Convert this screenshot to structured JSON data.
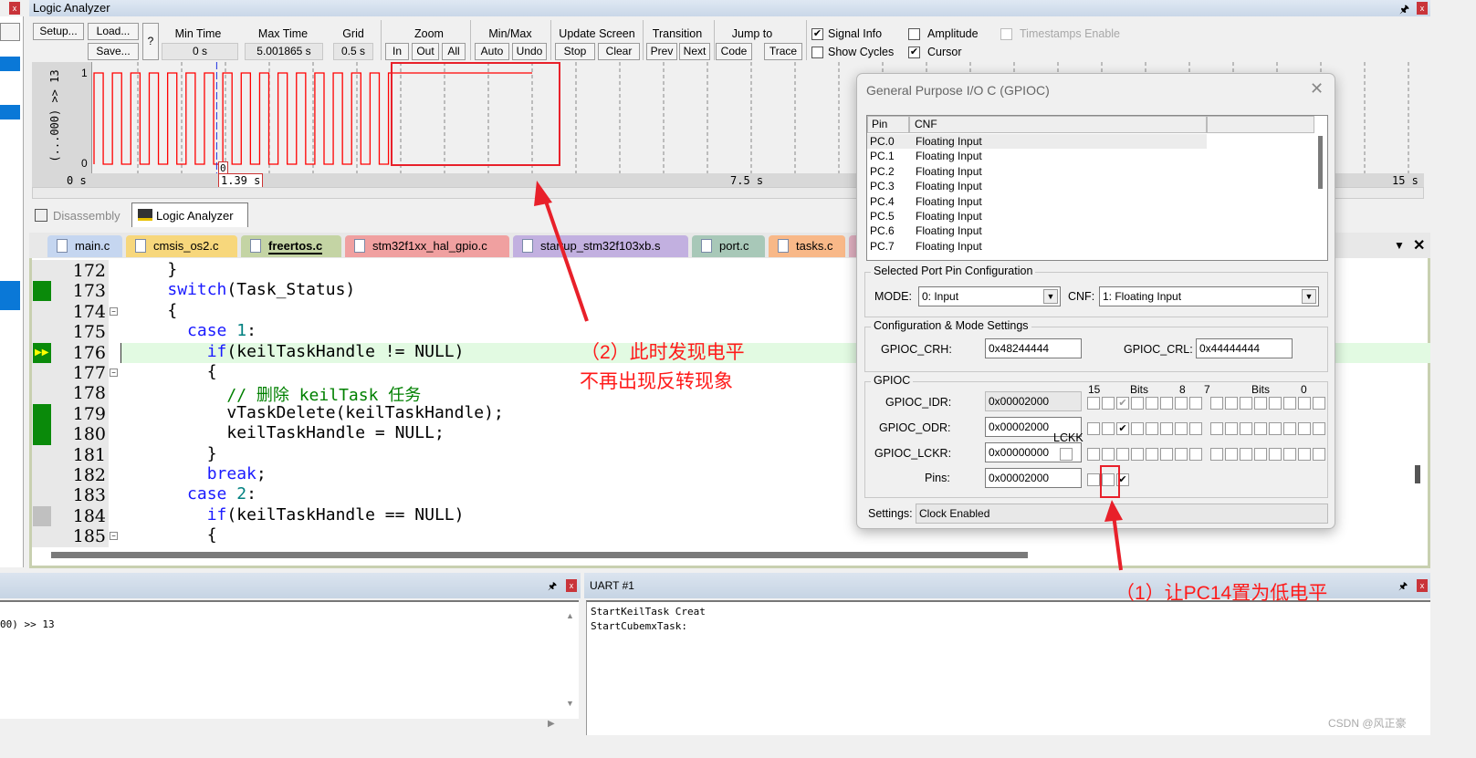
{
  "logic_analyzer": {
    "title": "Logic Analyzer",
    "buttons": {
      "setup": "Setup...",
      "load": "Load...",
      "save": "Save...",
      "help": "?"
    },
    "min_time": {
      "label": "Min Time",
      "value": "0 s"
    },
    "max_time": {
      "label": "Max Time",
      "value": "5.001865 s"
    },
    "grid": {
      "label": "Grid",
      "value": "0.5 s"
    },
    "zoom": {
      "label": "Zoom",
      "in": "In",
      "out": "Out",
      "all": "All"
    },
    "minmax": {
      "label": "Min/Max",
      "auto": "Auto",
      "undo": "Undo"
    },
    "update": {
      "label": "Update Screen",
      "stop": "Stop",
      "clear": "Clear"
    },
    "transition": {
      "label": "Transition",
      "prev": "Prev",
      "next": "Next"
    },
    "jump": {
      "label": "Jump to",
      "code": "Code",
      "trace": "Trace"
    },
    "options": [
      {
        "label": "Signal Info",
        "checked": true,
        "enabled": true
      },
      {
        "label": "Amplitude",
        "checked": false,
        "enabled": true
      },
      {
        "label": "Timestamps Enable",
        "checked": false,
        "enabled": false
      },
      {
        "label": "Show Cycles",
        "checked": false,
        "enabled": true
      },
      {
        "label": "Cursor",
        "checked": true,
        "enabled": true
      }
    ],
    "signal_name": "(...000) >> 13",
    "level_high": "1",
    "level_low": "0",
    "cursor_value": "0",
    "cursor_time": "1.39 s",
    "axis": {
      "start": "0 s",
      "mid": "7.5 s",
      "end": "15 s"
    },
    "waveform": {
      "period_s": 0.21,
      "toggle_until_s": 3.45,
      "end_s": 5.0,
      "final_level": 1,
      "cursor_s": 1.4,
      "color": "#ff0000"
    }
  },
  "view_tabs": [
    {
      "label": "Disassembly",
      "active": false
    },
    {
      "label": "Logic Analyzer",
      "active": true
    }
  ],
  "file_tabs": [
    {
      "label": "main.c",
      "color": "#c5d6f0"
    },
    {
      "label": "cmsis_os2.c",
      "color": "#f7d77c"
    },
    {
      "label": "freertos.c",
      "color": "#c4d4a4",
      "active": true
    },
    {
      "label": "stm32f1xx_hal_gpio.c",
      "color": "#f0a0a0"
    },
    {
      "label": "startup_stm32f103xb.s",
      "color": "#c2b0e0"
    },
    {
      "label": "port.c",
      "color": "#a8c8b8"
    },
    {
      "label": "tasks.c",
      "color": "#f8b888"
    }
  ],
  "code_lines": [
    {
      "n": "172",
      "html": "    }",
      "mark": ""
    },
    {
      "n": "173",
      "html": "    <span class='kw'>switch</span>(Task_Status)",
      "mark": "green"
    },
    {
      "n": "174",
      "html": "    {",
      "mark": "",
      "fold": true
    },
    {
      "n": "175",
      "html": "      <span class='kw'>case</span> <span class='num'>1</span>:",
      "mark": ""
    },
    {
      "n": "176",
      "html": "        <span class='kw'>if</span>(keilTaskHandle != NULL)",
      "mark": "arrow",
      "current": true
    },
    {
      "n": "177",
      "html": "        {",
      "mark": "",
      "fold": true
    },
    {
      "n": "178",
      "html": "          <span class='cm'>// 删除 keilTask 任务</span>",
      "mark": ""
    },
    {
      "n": "179",
      "html": "          vTaskDelete(keilTaskHandle);",
      "mark": "green"
    },
    {
      "n": "180",
      "html": "          keilTaskHandle = NULL;",
      "mark": "green"
    },
    {
      "n": "181",
      "html": "        }",
      "mark": ""
    },
    {
      "n": "182",
      "html": "        <span class='kw'>break</span>;",
      "mark": ""
    },
    {
      "n": "183",
      "html": "      <span class='kw'>case</span> <span class='num'>2</span>:",
      "mark": ""
    },
    {
      "n": "184",
      "html": "        <span class='kw'>if</span>(keilTaskHandle == NULL)",
      "mark": "grey"
    },
    {
      "n": "185",
      "html": "        {",
      "mark": "",
      "fold": true
    }
  ],
  "gpio_dialog": {
    "title": "General Purpose I/O C (GPIOC)",
    "columns": [
      "Pin",
      "CNF"
    ],
    "rows": [
      [
        "PC.0",
        "Floating Input"
      ],
      [
        "PC.1",
        "Floating Input"
      ],
      [
        "PC.2",
        "Floating Input"
      ],
      [
        "PC.3",
        "Floating Input"
      ],
      [
        "PC.4",
        "Floating Input"
      ],
      [
        "PC.5",
        "Floating Input"
      ],
      [
        "PC.6",
        "Floating Input"
      ],
      [
        "PC.7",
        "Floating Input"
      ]
    ],
    "selected_group": "Selected Port Pin Configuration",
    "mode_label": "MODE:",
    "mode_value": "0: Input",
    "cnf_label": "CNF:",
    "cnf_value": "1: Floating Input",
    "config_group": "Configuration & Mode Settings",
    "crh_label": "GPIOC_CRH:",
    "crh_value": "0x48244444",
    "crl_label": "GPIOC_CRL:",
    "crl_value": "0x44444444",
    "gpio_group": "GPIOC",
    "bits_hi": {
      "left": "15",
      "mid": "Bits",
      "right": "8"
    },
    "bits_lo": {
      "left": "7",
      "mid": "Bits",
      "right": "0"
    },
    "lckk_label": "LCKK",
    "idr_label": "GPIOC_IDR:",
    "idr_value": "0x00002000",
    "odr_label": "GPIOC_ODR:",
    "odr_value": "0x00002000",
    "lckr_label": "GPIOC_LCKR:",
    "lckr_value": "0x00000000",
    "pins_label": "Pins:",
    "pins_value": "0x00002000",
    "idr_bits": [
      13
    ],
    "odr_bits": [
      13
    ],
    "lckr_bits": [],
    "pins_bits": [
      13
    ],
    "settings_label": "Settings:",
    "settings_value": "Clock Enabled"
  },
  "command_panel": {
    "line": "00) >> 13"
  },
  "uart_panel": {
    "title": "UART #1",
    "lines": [
      "StartKeilTask Creat",
      "StartCubemxTask:"
    ]
  },
  "annotations": {
    "note2_line1": "（2）此时发现电平",
    "note2_line2": "不再出现反转现象",
    "note1": "（1）让PC14置为低电平",
    "color": "#ff1a1a"
  },
  "watermark": "CSDN @风正豪"
}
